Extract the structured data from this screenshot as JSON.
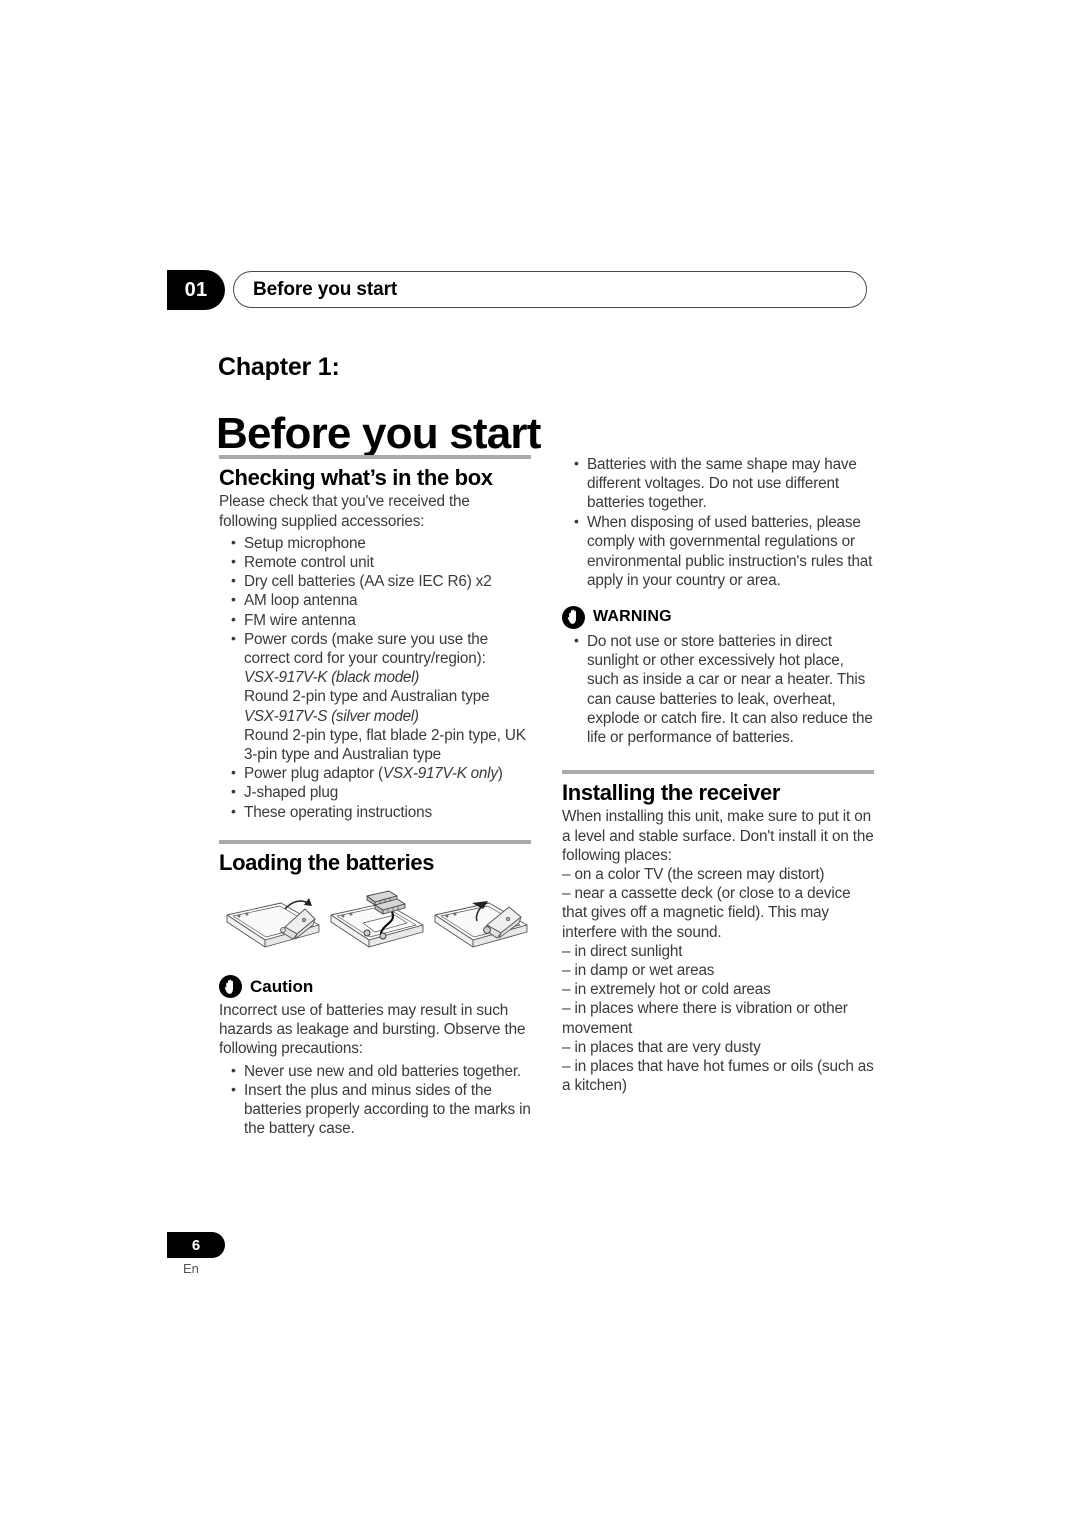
{
  "header": {
    "chapter_number": "01",
    "title": "Before you start"
  },
  "opener": {
    "chapter_label": "Chapter 1:",
    "chapter_title": "Before you start"
  },
  "left_column": {
    "section1": {
      "heading": "Checking what’s in the box",
      "intro": "Please check that you've received the following supplied accessories:",
      "items": [
        "Setup microphone",
        "Remote control unit",
        "Dry cell batteries (AA size IEC R6) x2",
        "AM loop antenna",
        "FM wire antenna"
      ],
      "power_cords_item": "Power cords (make sure you use the correct cord for your country/region):",
      "model_black_label": "VSX-917V-K (black model)",
      "model_black_text": "Round 2-pin type and Australian type",
      "model_silver_label": "VSX-917V-S (silver model)",
      "model_silver_text": "Round 2-pin type, flat blade 2-pin type, UK 3-pin type and Australian type",
      "adaptor_item_prefix": "Power plug adaptor (",
      "adaptor_item_italic": "VSX-917V-K only",
      "adaptor_item_suffix": ")",
      "final_items": [
        "J-shaped plug",
        "These operating instructions"
      ]
    },
    "section2": {
      "heading": "Loading the batteries",
      "illustration_caption": "remote-control-battery-loading-steps",
      "caution": {
        "icon": "hand-icon",
        "label": "Caution",
        "intro": "Incorrect use of batteries may result in such hazards as leakage and bursting. Observe the following precautions:",
        "items": [
          "Never use new and old batteries together.",
          "Insert the plus and minus sides of the batteries properly according to the marks in the battery case."
        ]
      }
    }
  },
  "right_column": {
    "battery_notes": [
      "Batteries with the same shape may have different voltages. Do not use different batteries together.",
      "When disposing of used batteries, please comply with governmental regulations or environmental public instruction's rules that apply in your country or area."
    ],
    "warning": {
      "icon": "hand-icon",
      "label": "WARNING",
      "items": [
        "Do not use or store batteries in direct sunlight or other excessively hot place, such as inside a car or near a heater. This can cause batteries to leak, overheat, explode or catch fire. It can also reduce the life or performance of batteries."
      ]
    },
    "section3": {
      "heading": "Installing the receiver",
      "intro": "When installing this unit, make sure to put it on a level and stable surface. Don't install it on the following places:",
      "places": [
        "– on a color TV (the screen may distort)",
        "– near a cassette deck (or close to a device that gives off a magnetic field). This may interfere with the sound.",
        "– in direct sunlight",
        "– in damp or wet areas",
        "– in extremely hot or cold areas",
        "– in places where there is vibration or other movement",
        "– in places that are very dusty",
        "– in places that have hot fumes or oils (such as a kitchen)"
      ]
    }
  },
  "footer": {
    "page_number": "6",
    "language_code": "En"
  },
  "colors": {
    "ink": "#000000",
    "body_text": "#3a3a3a",
    "rule": "#a9a9a9",
    "tab_background": "#000000",
    "tab_text": "#ffffff"
  }
}
